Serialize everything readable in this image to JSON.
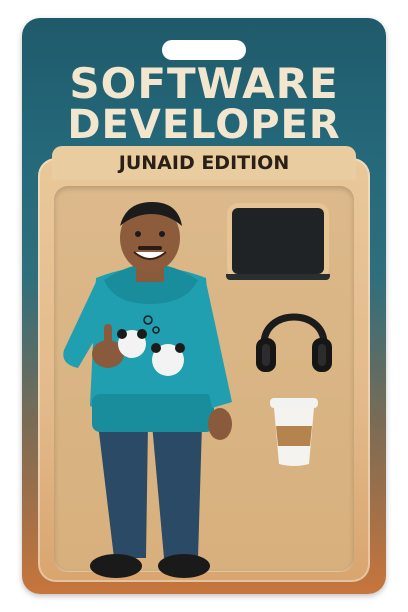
{
  "package": {
    "title_line1": "SOFTWARE",
    "title_line2": "DEVELOPER",
    "edition": "JUNAID EDITION"
  },
  "colors": {
    "card_top": "#1f5a6a",
    "card_bottom": "#c7753c",
    "title_text": "#f2e6cf",
    "blister": "#e2b98a",
    "hoodie": "#1f9fb0",
    "jeans": "#2b4a66"
  },
  "accessories": [
    "laptop-icon",
    "headphones-icon",
    "coffee-cup-icon"
  ]
}
